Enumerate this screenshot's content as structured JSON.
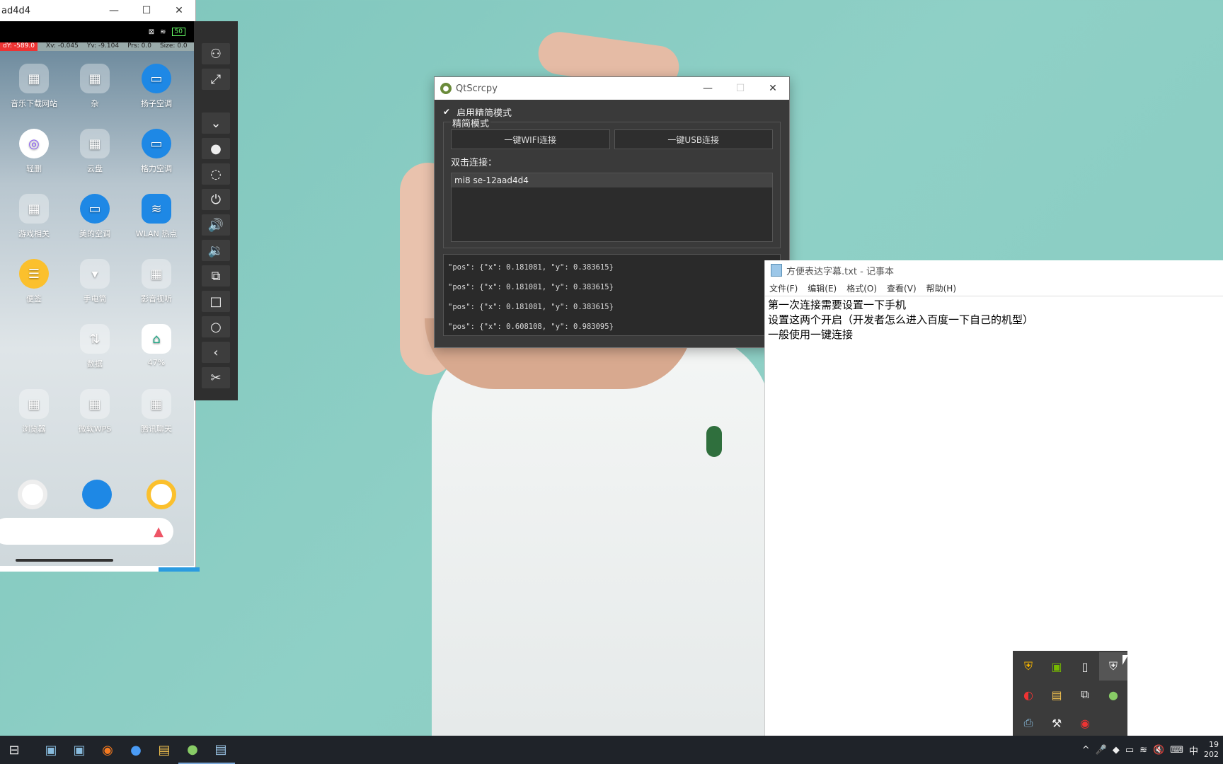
{
  "phone": {
    "title": "ad4d4",
    "status": {
      "battery": "50"
    },
    "pointer": {
      "dy": "dY: -589.0",
      "xv": "Xv: -0.045",
      "yv": "Yv: -9.104",
      "prs": "Prs: 0.0",
      "size": "Size: 0.0"
    },
    "apps": [
      {
        "label": "音乐下载网站",
        "icon": "folder-icon"
      },
      {
        "label": "杂",
        "icon": "folder-icon"
      },
      {
        "label": "扬子空调",
        "icon": "aircon-icon"
      },
      {
        "label": "轻删",
        "icon": "app-icon"
      },
      {
        "label": "云盘",
        "icon": "folder-icon"
      },
      {
        "label": "格力空调",
        "icon": "aircon-icon"
      },
      {
        "label": "游戏相关",
        "icon": "folder-icon"
      },
      {
        "label": "美的空调",
        "icon": "aircon-icon"
      },
      {
        "label": "WLAN 热点",
        "icon": "wifi-icon"
      },
      {
        "label": "便签",
        "icon": "notes-icon"
      },
      {
        "label": "手电筒",
        "icon": "flashlight-icon"
      },
      {
        "label": "影音视听",
        "icon": "folder-icon"
      },
      {
        "label": "数据",
        "icon": "data-icon"
      },
      {
        "label": "47%",
        "icon": "cleaner-icon"
      },
      {
        "label": "浏览器",
        "icon": "folder-icon"
      },
      {
        "label": "微软WPS",
        "icon": "folder-icon"
      },
      {
        "label": "腾讯聊天",
        "icon": "folder-icon"
      }
    ]
  },
  "toolbar": {
    "items": [
      "group-icon",
      "fullscreen-icon",
      "expand-down-icon",
      "record-icon",
      "hide-icon",
      "power-icon",
      "volume-up-icon",
      "volume-down-icon",
      "rotate-icon",
      "overview-icon",
      "home-icon",
      "back-icon",
      "screenshot-icon"
    ]
  },
  "qt": {
    "title": "QtScrcpy",
    "simple_mode_label": "启用精简模式",
    "group_title": "精简模式",
    "wifi_btn": "一键WIFI连接",
    "usb_btn": "一键USB连接",
    "dbl_label": "双击连接：",
    "device": "mi8 se-12aad4d4",
    "log": [
      "\"pos\": {\"x\": 0.181081, \"y\": 0.383615}",
      "\"pos\": {\"x\": 0.181081, \"y\": 0.383615}",
      "\"pos\": {\"x\": 0.181081, \"y\": 0.383615}",
      "\"pos\": {\"x\": 0.608108, \"y\": 0.983095}"
    ]
  },
  "notepad": {
    "title": "方便表达字幕.txt - 记事本",
    "menu": [
      "文件(F)",
      "编辑(E)",
      "格式(O)",
      "查看(V)",
      "帮助(H)"
    ],
    "lines": [
      "第一次连接需要设置一下手机",
      "设置这两个开启（开发者怎么进入百度一下自己的机型）",
      "一般使用一键连接"
    ]
  },
  "taskbar": {
    "ime": "中",
    "time": "19",
    "date": "202"
  }
}
